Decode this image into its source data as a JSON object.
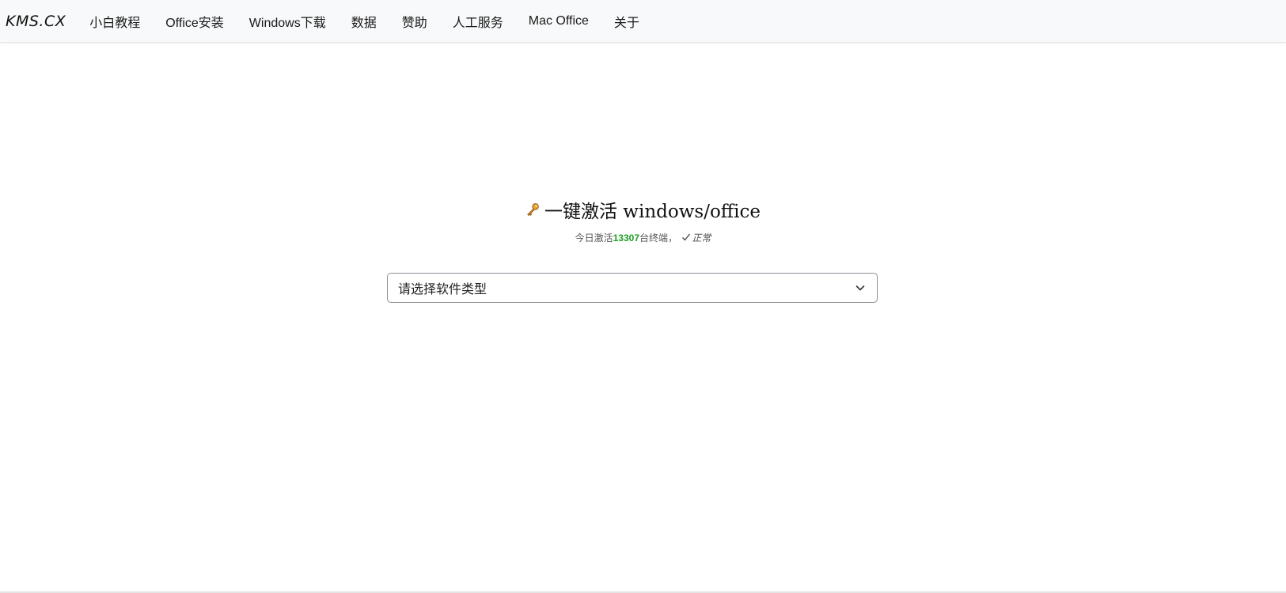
{
  "navbar": {
    "brand": "KMS.CX",
    "links": [
      {
        "label": "小白教程"
      },
      {
        "label": "Office安装"
      },
      {
        "label": "Windows下载"
      },
      {
        "label": "数据"
      },
      {
        "label": "赞助"
      },
      {
        "label": "人工服务"
      },
      {
        "label": "Mac Office"
      },
      {
        "label": "关于"
      }
    ]
  },
  "hero": {
    "title": "一键激活 windows/office",
    "sub_prefix": "今日激活",
    "count": "13307",
    "sub_suffix": "台终端，",
    "status": "正常",
    "icon": "key-icon"
  },
  "select": {
    "value": "请选择软件类型",
    "icon": "chevron-down-icon"
  },
  "colors": {
    "count": "#1e9e27",
    "navbar_bg": "#f8f9fa"
  }
}
